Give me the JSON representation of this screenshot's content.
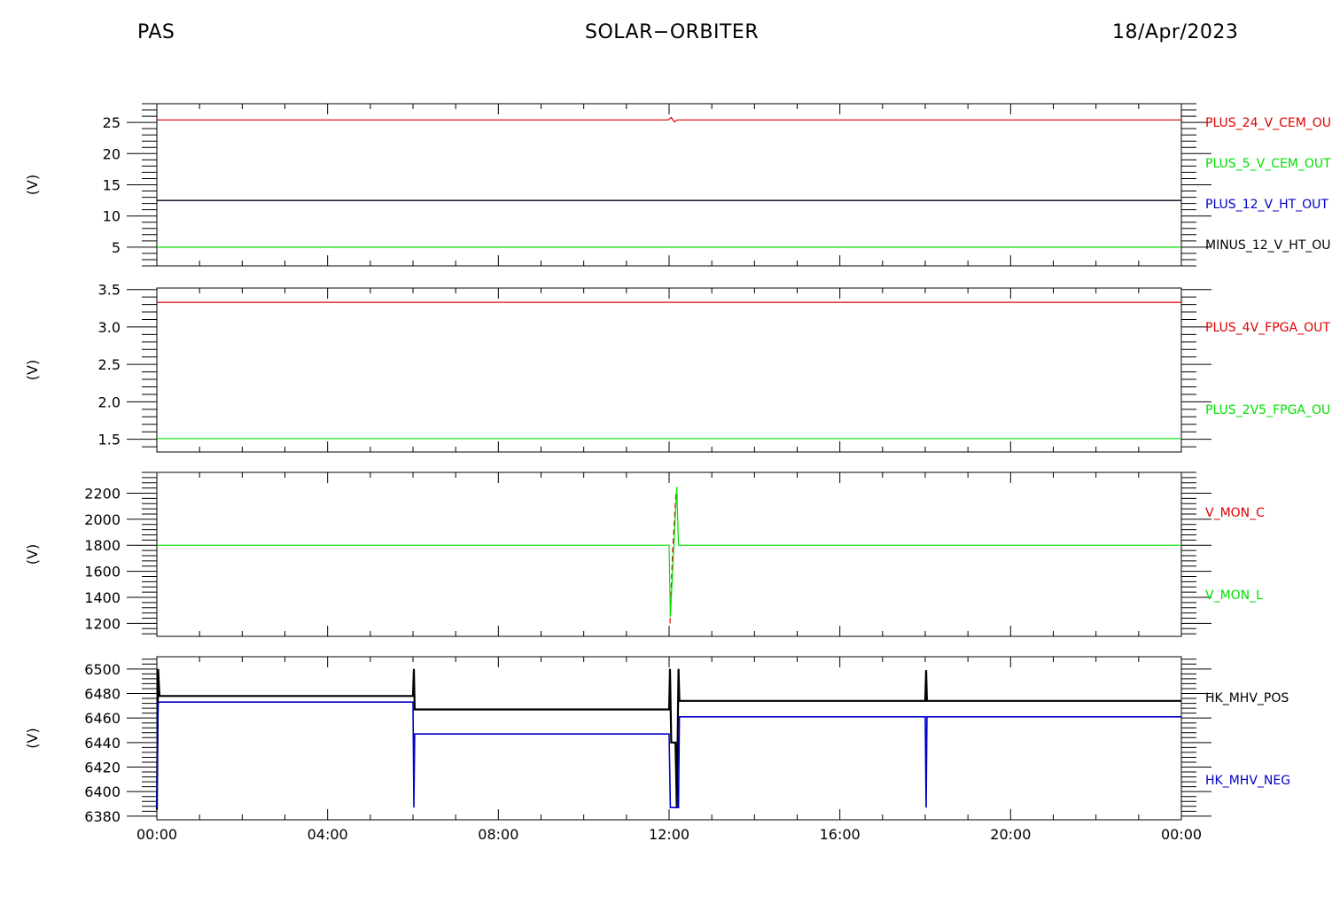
{
  "header": {
    "left": "PAS",
    "center": "SOLAR−ORBITER",
    "right": "18/Apr/2023"
  },
  "colors": {
    "red": "#e00000",
    "green": "#00e000",
    "blue": "#0000c8",
    "black": "#000000"
  },
  "chart_data": [
    {
      "type": "line",
      "ylabel": "(V)",
      "ylim": [
        2.0,
        28.0
      ],
      "yticks": [
        5,
        10,
        15,
        20,
        25
      ],
      "xlim": [
        0,
        24
      ],
      "xticks": [
        0,
        4,
        8,
        12,
        16,
        20,
        24
      ],
      "x_tick_labels": [
        "00:00",
        "04:00",
        "08:00",
        "12:00",
        "16:00",
        "20:00",
        "00:00"
      ],
      "series": [
        {
          "name": "PLUS_24_V_CEM_OU",
          "color": "red",
          "points": [
            [
              0,
              25.4
            ],
            [
              11.98,
              25.4
            ],
            [
              12.05,
              25.8
            ],
            [
              12.12,
              25.1
            ],
            [
              12.2,
              25.4
            ],
            [
              24,
              25.4
            ]
          ]
        },
        {
          "name": "PLUS_5_V_CEM_OUT",
          "color": "green",
          "points": [
            [
              0,
              5.0
            ],
            [
              24,
              5.0
            ]
          ]
        },
        {
          "name": "PLUS_12_V_HT_OUT",
          "color": "blue",
          "points": [
            [
              0,
              12.5
            ],
            [
              24,
              12.5
            ]
          ]
        },
        {
          "name": "MINUS_12_V_HT_OU",
          "color": "black",
          "points": [
            [
              0,
              12.5
            ],
            [
              24,
              12.5
            ]
          ]
        }
      ]
    },
    {
      "type": "line",
      "ylabel": "(V)",
      "ylim": [
        1.33,
        3.52
      ],
      "yticks": [
        1.5,
        2.0,
        2.5,
        3.0,
        3.5
      ],
      "ytick_labels": [
        "1.5",
        "2.0",
        "2.5",
        "3.0",
        "3.5"
      ],
      "xlim": [
        0,
        24
      ],
      "xticks": [
        0,
        4,
        8,
        12,
        16,
        20,
        24
      ],
      "series": [
        {
          "name": "PLUS_4V_FPGA_OUT",
          "color": "red",
          "points": [
            [
              0,
              3.33
            ],
            [
              24,
              3.33
            ]
          ]
        },
        {
          "name": "PLUS_2V5_FPGA_OU",
          "color": "green",
          "points": [
            [
              0,
              1.51
            ],
            [
              24,
              1.51
            ]
          ]
        }
      ]
    },
    {
      "type": "line",
      "ylabel": "(V)",
      "ylim": [
        1100,
        2360
      ],
      "yticks": [
        1200,
        1400,
        1600,
        1800,
        2000,
        2200
      ],
      "xlim": [
        0,
        24
      ],
      "xticks": [
        0,
        4,
        8,
        12,
        16,
        20,
        24
      ],
      "series": [
        {
          "name": "V_MON_C",
          "color": "red",
          "dashed": true,
          "points": [
            [
              12.02,
              1200
            ],
            [
              12.08,
              1750
            ],
            [
              12.16,
              2200
            ]
          ]
        },
        {
          "name": "V_MON_L",
          "color": "green",
          "points": [
            [
              0,
              1800
            ],
            [
              12.0,
              1800
            ],
            [
              12.03,
              1250
            ],
            [
              12.18,
              2250
            ],
            [
              12.22,
              1800
            ],
            [
              24,
              1800
            ]
          ]
        }
      ]
    },
    {
      "type": "line",
      "ylabel": "(V)",
      "ylim": [
        6377,
        6510
      ],
      "yticks": [
        6380,
        6400,
        6420,
        6440,
        6460,
        6480,
        6500
      ],
      "xlim": [
        0,
        24
      ],
      "xticks": [
        0,
        4,
        8,
        12,
        16,
        20,
        24
      ],
      "x_tick_labels": [
        "00:00",
        "04:00",
        "08:00",
        "12:00",
        "16:00",
        "20:00",
        "00:00"
      ],
      "series": [
        {
          "name": "HK_MHV_POS",
          "color": "black",
          "width": 2.2,
          "points": [
            [
              0,
              6385
            ],
            [
              0.03,
              6500
            ],
            [
              0.06,
              6478
            ],
            [
              6.0,
              6478
            ],
            [
              6.02,
              6500
            ],
            [
              6.04,
              6467
            ],
            [
              12.0,
              6467
            ],
            [
              12.02,
              6500
            ],
            [
              12.05,
              6440
            ],
            [
              12.15,
              6440
            ],
            [
              12.18,
              6387
            ],
            [
              12.22,
              6500
            ],
            [
              12.24,
              6474
            ],
            [
              18.0,
              6474
            ],
            [
              18.02,
              6499
            ],
            [
              18.04,
              6474
            ],
            [
              24,
              6474
            ]
          ]
        },
        {
          "name": "HK_MHV_NEG",
          "color": "blue",
          "width": 1.6,
          "points": [
            [
              0,
              6387
            ],
            [
              0.03,
              6472
            ],
            [
              0.06,
              6473
            ],
            [
              6.0,
              6473
            ],
            [
              6.02,
              6387
            ],
            [
              6.04,
              6447
            ],
            [
              12.0,
              6447
            ],
            [
              12.03,
              6387
            ],
            [
              12.22,
              6387
            ],
            [
              12.24,
              6461
            ],
            [
              18.0,
              6461
            ],
            [
              18.02,
              6387
            ],
            [
              18.04,
              6461
            ],
            [
              24,
              6461
            ]
          ]
        }
      ]
    }
  ]
}
